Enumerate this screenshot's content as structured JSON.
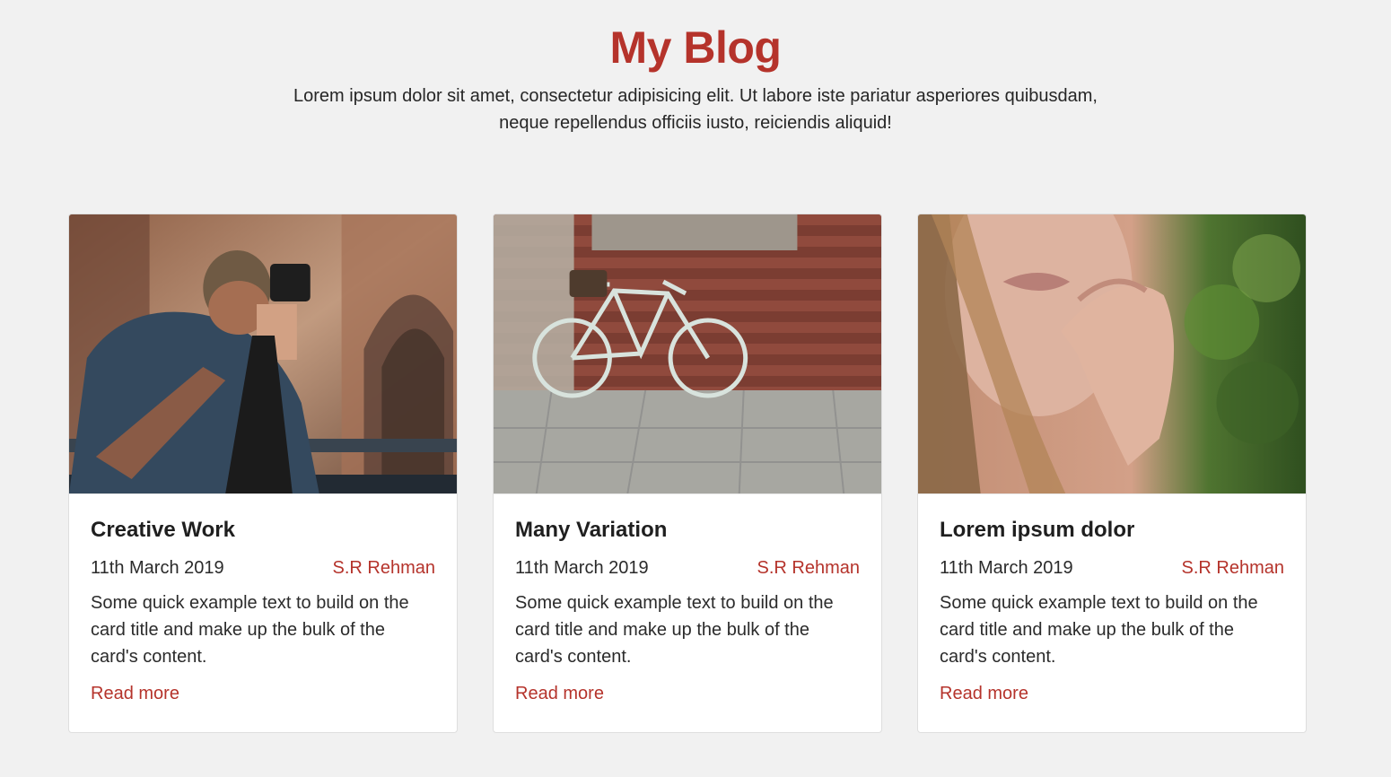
{
  "header": {
    "title": "My Blog",
    "intro_line_1": "Lorem ipsum dolor sit amet, consectetur adipisicing elit. Ut labore iste pariatur asperiores quibusdam,",
    "intro_line_2": "neque repellendus officiis iusto, reiciendis aliquid!"
  },
  "colors": {
    "accent": "#b5332b",
    "background": "#f1f1f1",
    "card": "#ffffff"
  },
  "cards": [
    {
      "image_icon": "photographer-image",
      "title": "Creative Work",
      "date": "11th March 2019",
      "author": "S.R Rehman",
      "text": "Some quick example text to build on the card title and make up the bulk of the card's content.",
      "link": "Read more"
    },
    {
      "image_icon": "bicycle-image",
      "title": "Many Variation",
      "date": "11th March 2019",
      "author": "S.R Rehman",
      "text": "Some quick example text to build on the card title and make up the bulk of the card's content.",
      "link": "Read more"
    },
    {
      "image_icon": "portrait-image",
      "title": "Lorem ipsum dolor",
      "date": "11th March 2019",
      "author": "S.R Rehman",
      "text": "Some quick example text to build on the card title and make up the bulk of the card's content.",
      "link": "Read more"
    }
  ]
}
